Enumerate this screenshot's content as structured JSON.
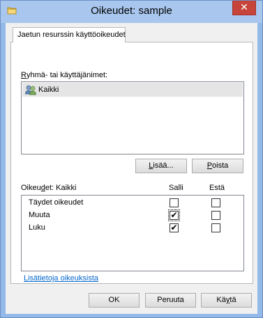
{
  "window": {
    "title": "Oikeudet: sample",
    "close_symbol": "✕",
    "title_icon": "folder-icon"
  },
  "tabs": [
    {
      "label": "Jaetun resurssin käyttöoikeudet"
    }
  ],
  "group_label": {
    "hotkey": "R",
    "rest": "yhmä- tai käyttäjänimet:"
  },
  "users": [
    {
      "name": "Kaikki",
      "icon": "users-group-icon"
    }
  ],
  "buttons": {
    "add": {
      "hotkey": "L",
      "rest": "isää..."
    },
    "remove": {
      "hotkey": "P",
      "rest": "oista"
    },
    "ok": "OK",
    "cancel": "Peruuta",
    "apply": {
      "pre": "Kä",
      "hotkey": "y",
      "post": "tä"
    }
  },
  "permissions": {
    "header": {
      "pre": "Oikeu",
      "hotkey": "d",
      "post": "et: Kaikki"
    },
    "allow_col": "Salli",
    "deny_col": "Estä",
    "rows": [
      {
        "name": "Täydet oikeudet",
        "allow": "",
        "deny": ""
      },
      {
        "name": "Muuta",
        "allow": "✔",
        "deny": ""
      },
      {
        "name": "Luku",
        "allow": "✔",
        "deny": ""
      }
    ]
  },
  "more_info_link": "Lisätietoja oikeuksista"
}
